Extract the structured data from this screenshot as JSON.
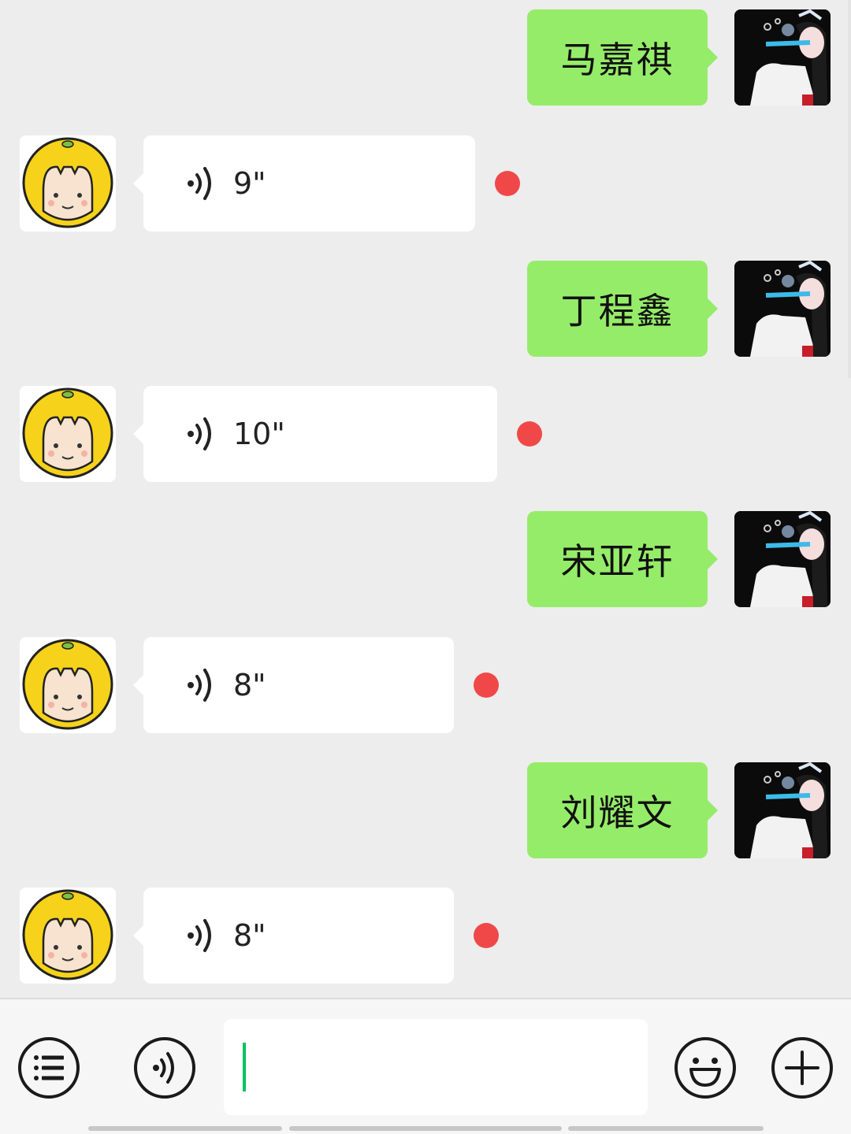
{
  "messages": [
    {
      "side": "right",
      "text": "马嘉祺"
    },
    {
      "side": "left",
      "type": "voice",
      "duration": "9\"",
      "unread": true
    },
    {
      "side": "right",
      "text": "丁程鑫"
    },
    {
      "side": "left",
      "type": "voice",
      "duration": "10\"",
      "unread": true
    },
    {
      "side": "right",
      "text": "宋亚轩"
    },
    {
      "side": "left",
      "type": "voice",
      "duration": "8\"",
      "unread": true
    },
    {
      "side": "right",
      "text": "刘耀文"
    },
    {
      "side": "left",
      "type": "voice",
      "duration": "8\"",
      "unread": true
    }
  ],
  "input_bar": {
    "text_value": "",
    "buttons": [
      "menu-icon",
      "voice-icon",
      "emoji-icon",
      "plus-icon"
    ]
  },
  "colors": {
    "background": "#ededed",
    "sent_bubble": "#95ec69",
    "received_bubble": "#ffffff",
    "unread_dot": "#f04848",
    "caret": "#07c160"
  }
}
